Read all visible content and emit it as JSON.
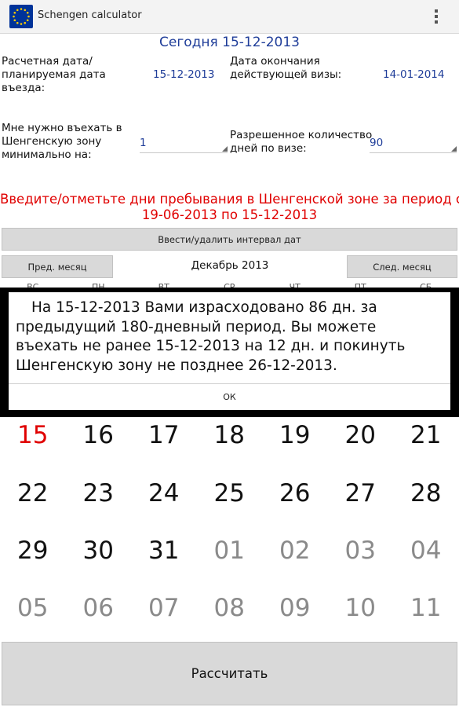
{
  "app": {
    "title": "Schengen calculator"
  },
  "header": {
    "today": "Сегодня  15-12-2013"
  },
  "form": {
    "calc_date_label": [
      "Расчетная дата/",
      "планируемая дата",
      "въезда:"
    ],
    "calc_date_value": "15-12-2013",
    "visa_end_label": [
      "Дата окончания",
      "действующей визы:"
    ],
    "visa_end_value": "14-01-2014",
    "min_days_label": [
      "Мне нужно въехать в",
      "Шенгенскую зону",
      "минимально на:"
    ],
    "min_days_value": "1",
    "allowed_days_label": [
      "Разрешенное количество",
      "дней по визе:"
    ],
    "allowed_days_value": "90"
  },
  "warning": {
    "line1": "Введите/отметьте дни пребывания в Шенгенской зоне за период с",
    "line2": "19-06-2013 по 15-12-2013"
  },
  "buttons": {
    "interval": "Ввести/удалить интервал дат",
    "prev_month": "Пред. месяц",
    "next_month": "След. месяц",
    "calculate": "Рассчитать"
  },
  "calendar": {
    "month": "Декабрь 2013",
    "weekdays": [
      "ВС",
      "ПН",
      "ВТ",
      "СР",
      "ЧТ",
      "ПТ",
      "СБ"
    ],
    "rows": [
      [
        {
          "d": "15",
          "t": "today"
        },
        {
          "d": "16"
        },
        {
          "d": "17"
        },
        {
          "d": "18"
        },
        {
          "d": "19"
        },
        {
          "d": "20"
        },
        {
          "d": "21"
        }
      ],
      [
        {
          "d": "22"
        },
        {
          "d": "23"
        },
        {
          "d": "24"
        },
        {
          "d": "25"
        },
        {
          "d": "26"
        },
        {
          "d": "27"
        },
        {
          "d": "28"
        }
      ],
      [
        {
          "d": "29"
        },
        {
          "d": "30"
        },
        {
          "d": "31"
        },
        {
          "d": "01",
          "t": "other"
        },
        {
          "d": "02",
          "t": "other"
        },
        {
          "d": "03",
          "t": "other"
        },
        {
          "d": "04",
          "t": "other"
        }
      ],
      [
        {
          "d": "05",
          "t": "other"
        },
        {
          "d": "06",
          "t": "other"
        },
        {
          "d": "07",
          "t": "other"
        },
        {
          "d": "08",
          "t": "other"
        },
        {
          "d": "09",
          "t": "other"
        },
        {
          "d": "10",
          "t": "other"
        },
        {
          "d": "11",
          "t": "other"
        }
      ]
    ]
  },
  "dialog": {
    "message": "На 15-12-2013 Вами израсходовано 86 дн. за предыдущий 180-дневный период. Вы можете въехать не ранее 15-12-2013 на 12 дн. и покинуть Шенгенскую зону не позднее 26-12-2013.",
    "ok": "ОК"
  },
  "colors": {
    "accent": "#1f3d99",
    "warning": "#e00000",
    "button": "#d9d9d9",
    "eu_blue": "#003399",
    "eu_star": "#ffcc00"
  },
  "icons": {
    "app": "eu-flag-icon",
    "menu": "overflow-menu-icon",
    "spinner": "dropdown-triangle-icon"
  }
}
